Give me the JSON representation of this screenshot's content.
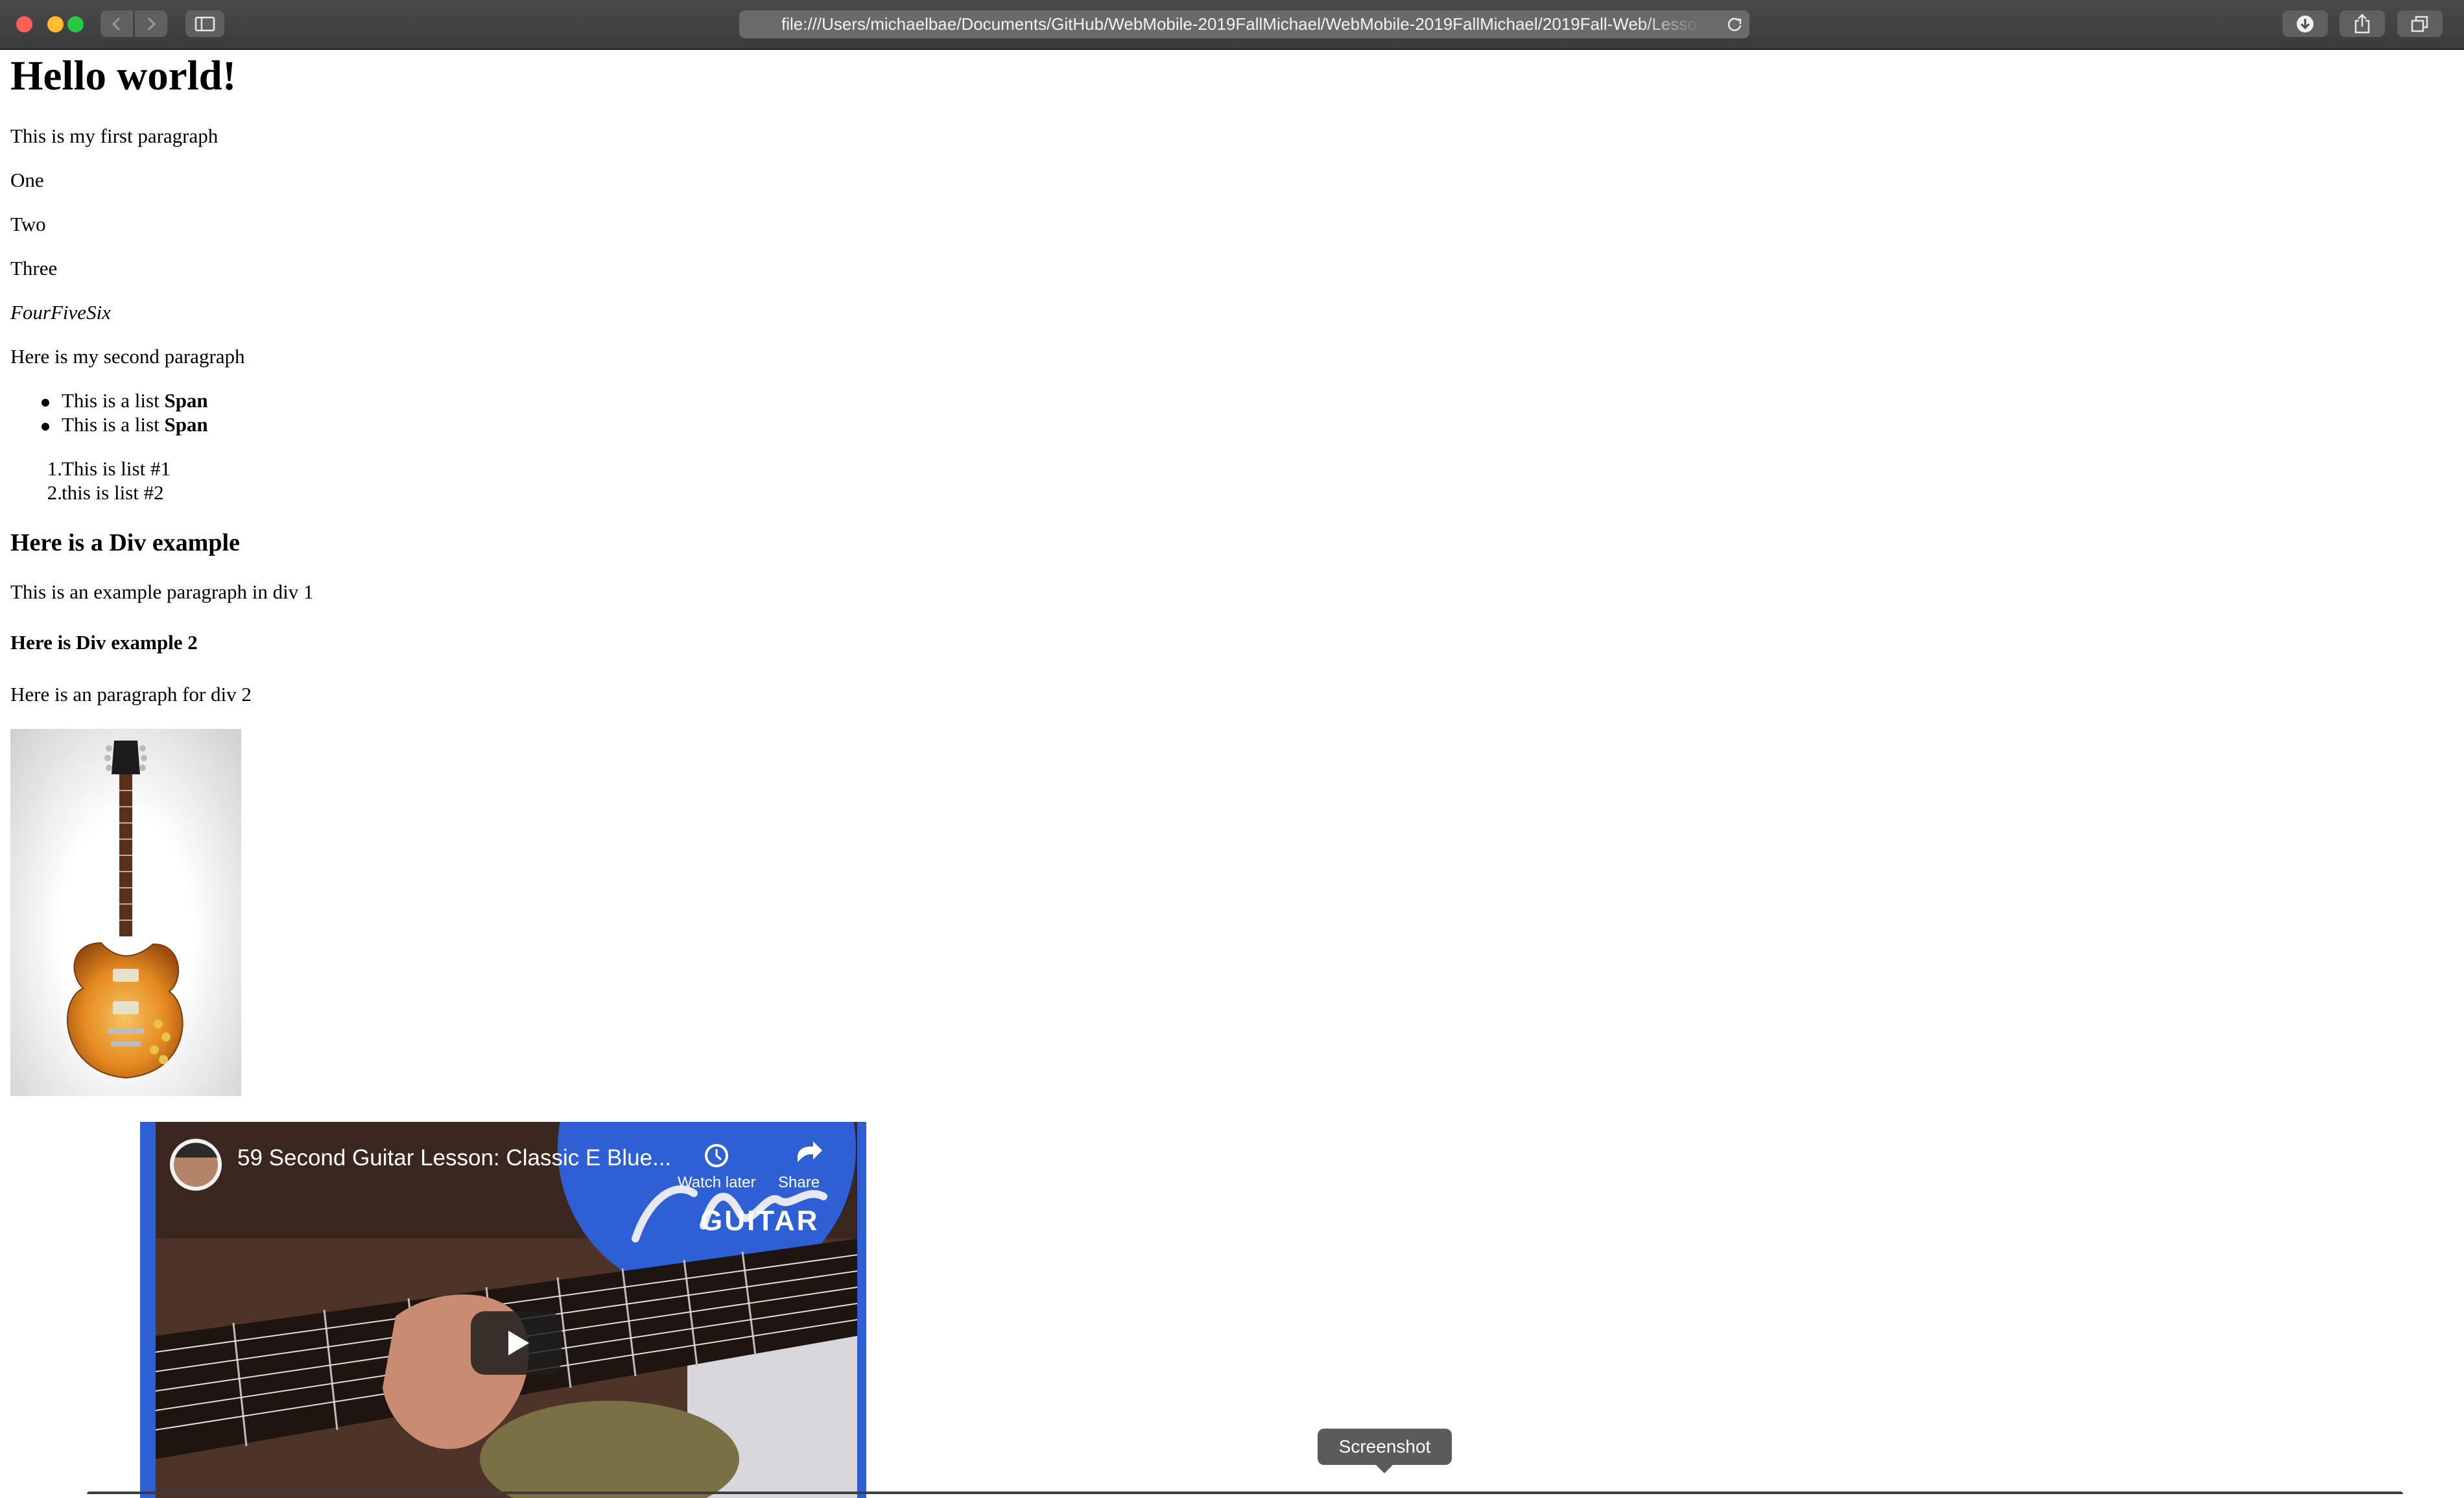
{
  "browser": {
    "url": "file:///Users/michaelbae/Documents/GitHub/WebMobile-2019FallMichael/WebMobile-2019FallMichael/2019Fall-Web/Lesson2/",
    "icons": [
      "back-icon",
      "forward-icon",
      "sidebar-icon",
      "reload-icon",
      "download-icon",
      "share-icon",
      "tabs-icon"
    ]
  },
  "page": {
    "heading": "Hello world!",
    "paragraph1": "This is my first paragraph",
    "one": "One",
    "two": "Two",
    "three": "Three",
    "four_five_six": "FourFiveSix",
    "paragraph2": "Here is my second paragraph",
    "bullet_list": [
      {
        "text": "This is a list ",
        "bold": "Span"
      },
      {
        "text": "This is a list ",
        "bold": "Span"
      }
    ],
    "ordered_list": [
      {
        "num": "1.",
        "text": "This is list #1"
      },
      {
        "num": "2.",
        "text": "this is list #2"
      }
    ],
    "div1_heading": "Here is a Div example",
    "div1_paragraph": "This is an example paragraph in div 1",
    "div2_heading": "Here is Div example 2",
    "div2_paragraph": "Here is an paragraph for div 2"
  },
  "video": {
    "title": "59 Second Guitar Lesson: Classic E Blue...",
    "watch_later": "Watch later",
    "share": "Share",
    "brand": "GUITAR"
  },
  "tooltip": "Screenshot"
}
